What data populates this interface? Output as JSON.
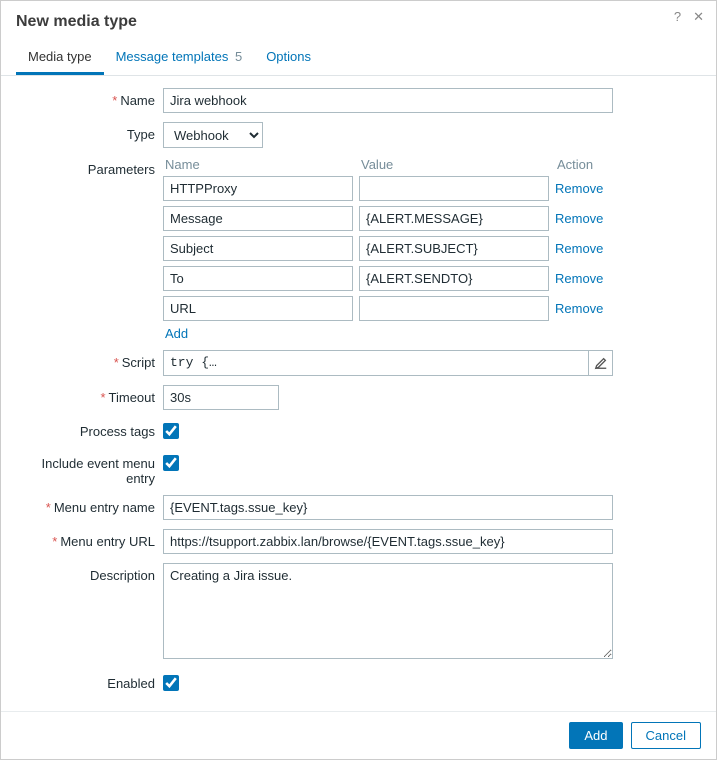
{
  "dialog": {
    "title": "New media type"
  },
  "tabs": {
    "media_type": "Media type",
    "message_templates": "Message templates",
    "message_templates_count": "5",
    "options": "Options"
  },
  "labels": {
    "name": "Name",
    "type": "Type",
    "parameters": "Parameters",
    "script": "Script",
    "timeout": "Timeout",
    "process_tags": "Process tags",
    "include_menu_entry": "Include event menu entry",
    "menu_entry_name": "Menu entry name",
    "menu_entry_url": "Menu entry URL",
    "description": "Description",
    "enabled": "Enabled"
  },
  "param_headers": {
    "name": "Name",
    "value": "Value",
    "action": "Action"
  },
  "fields": {
    "name": "Jira webhook",
    "type": "Webhook",
    "script": "try {…",
    "timeout": "30s",
    "process_tags": true,
    "include_menu_entry": true,
    "menu_entry_name": "{EVENT.tags.ssue_key}",
    "menu_entry_url": "https://tsupport.zabbix.lan/browse/{EVENT.tags.ssue_key}",
    "description": "Creating a Jira issue.",
    "enabled": true
  },
  "parameters": [
    {
      "name": "HTTPProxy",
      "value": ""
    },
    {
      "name": "Message",
      "value": "{ALERT.MESSAGE}"
    },
    {
      "name": "Subject",
      "value": "{ALERT.SUBJECT}"
    },
    {
      "name": "To",
      "value": "{ALERT.SENDTO}"
    },
    {
      "name": "URL",
      "value": ""
    }
  ],
  "actions": {
    "remove": "Remove",
    "add": "Add"
  },
  "buttons": {
    "add": "Add",
    "cancel": "Cancel"
  }
}
